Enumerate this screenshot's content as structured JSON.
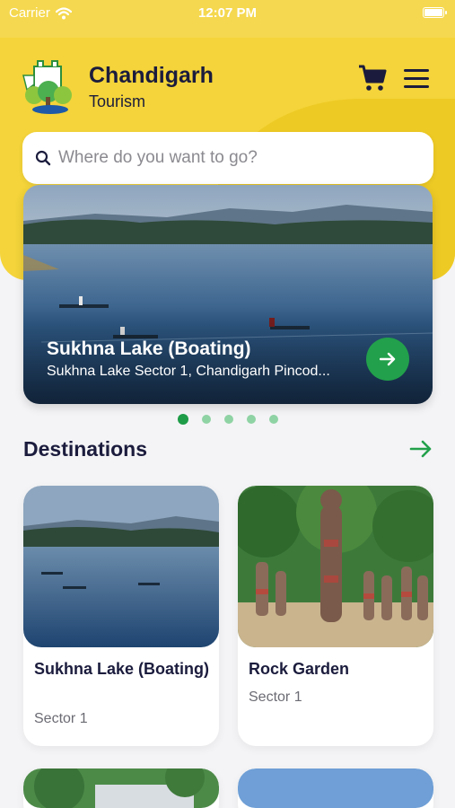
{
  "status_bar": {
    "carrier": "Carrier",
    "time": "12:07 PM"
  },
  "header": {
    "title": "Chandigarh",
    "subtitle": "Tourism"
  },
  "search": {
    "placeholder": "Where do you want to go?",
    "value": ""
  },
  "hero": {
    "title": "Sukhna Lake (Boating)",
    "address": "Sukhna Lake Sector 1, Chandigarh Pincod..."
  },
  "carousel": {
    "total": 5,
    "active": 0
  },
  "destinations": {
    "heading": "Destinations",
    "cards": [
      {
        "title": "Sukhna Lake (Boating)",
        "sector": "Sector 1"
      },
      {
        "title": "Rock Garden",
        "sector": "Sector 1"
      }
    ]
  },
  "colors": {
    "header_yellow": "#f4d43a",
    "accent_green": "#22a04b",
    "text_dark": "#1b1c3d"
  }
}
